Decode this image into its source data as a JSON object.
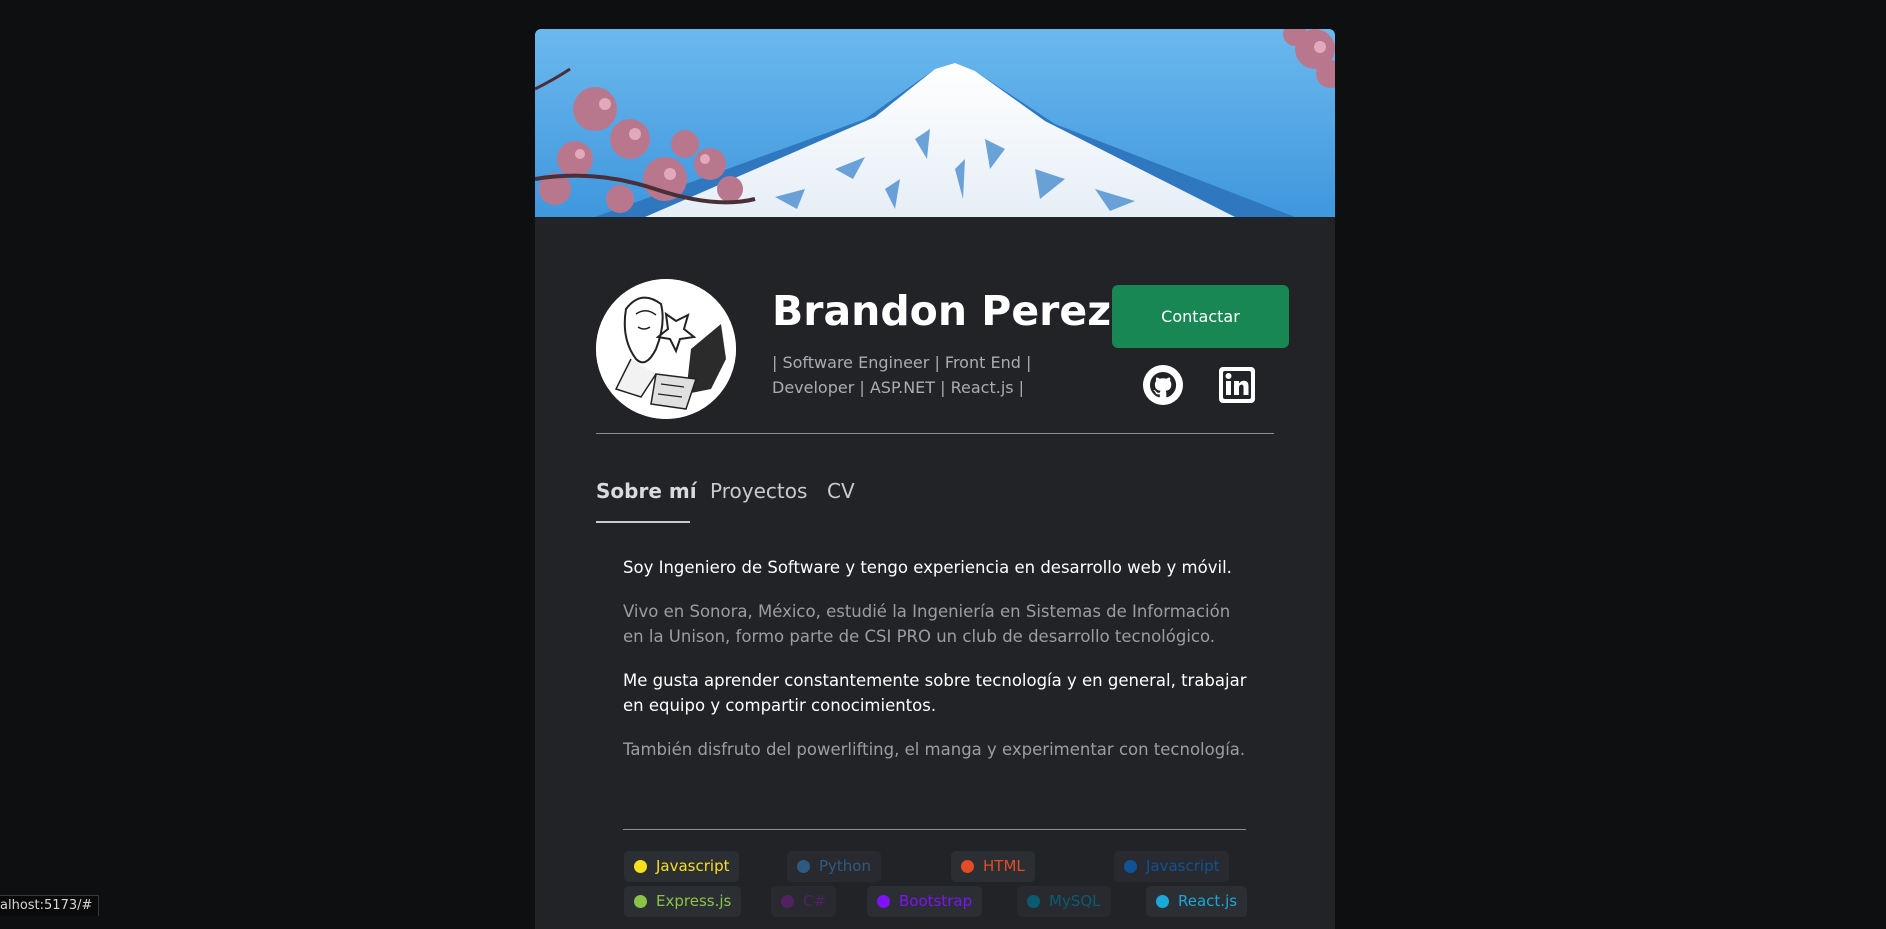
{
  "profile": {
    "name": "Brandon Perez",
    "subtitle": "| Software Engineer | Front End | Developer | ASP.NET | React.js |",
    "contact_label": "Contactar"
  },
  "social": {
    "github_icon": "github-icon",
    "linkedin_icon": "linkedin-icon"
  },
  "tabs": [
    {
      "label": "Sobre mí",
      "active": true
    },
    {
      "label": "Proyectos",
      "active": false
    },
    {
      "label": "CV",
      "active": false
    }
  ],
  "about": {
    "p1": "Soy Ingeniero de Software y tengo experiencia en desarrollo web y móvil.",
    "p2": "Vivo en Sonora, México, estudié la Ingeniería en Sistemas de Información en la Unison, formo parte de CSI PRO un club de desarrollo tecnológico.",
    "p3": "Me gusta aprender constantemente sobre tecnología y en general, trabajar en equipo y compartir conocimientos.",
    "p4": "También disfruto del powerlifting, el manga y experimentar con tecnología."
  },
  "skills": [
    {
      "label": "Javascript",
      "color": "#f7df1e"
    },
    {
      "label": "Python",
      "color": "#3572a5"
    },
    {
      "label": "HTML",
      "color": "#e34c26"
    },
    {
      "label": "Javascript",
      "color": "#0a66c2"
    },
    {
      "label": "Express.js",
      "color": "#8bc34a"
    },
    {
      "label": "C#",
      "color": "#68217a"
    },
    {
      "label": "Bootstrap",
      "color": "#7e13f7"
    },
    {
      "label": "MySQL",
      "color": "#00758f"
    },
    {
      "label": "React.js",
      "color": "#1ba8d8"
    }
  ],
  "colors": {
    "accent_green": "#198754",
    "card_bg": "#212327",
    "page_bg": "#0e0f10"
  },
  "status_bar": {
    "url": "alhost:5173/#"
  }
}
